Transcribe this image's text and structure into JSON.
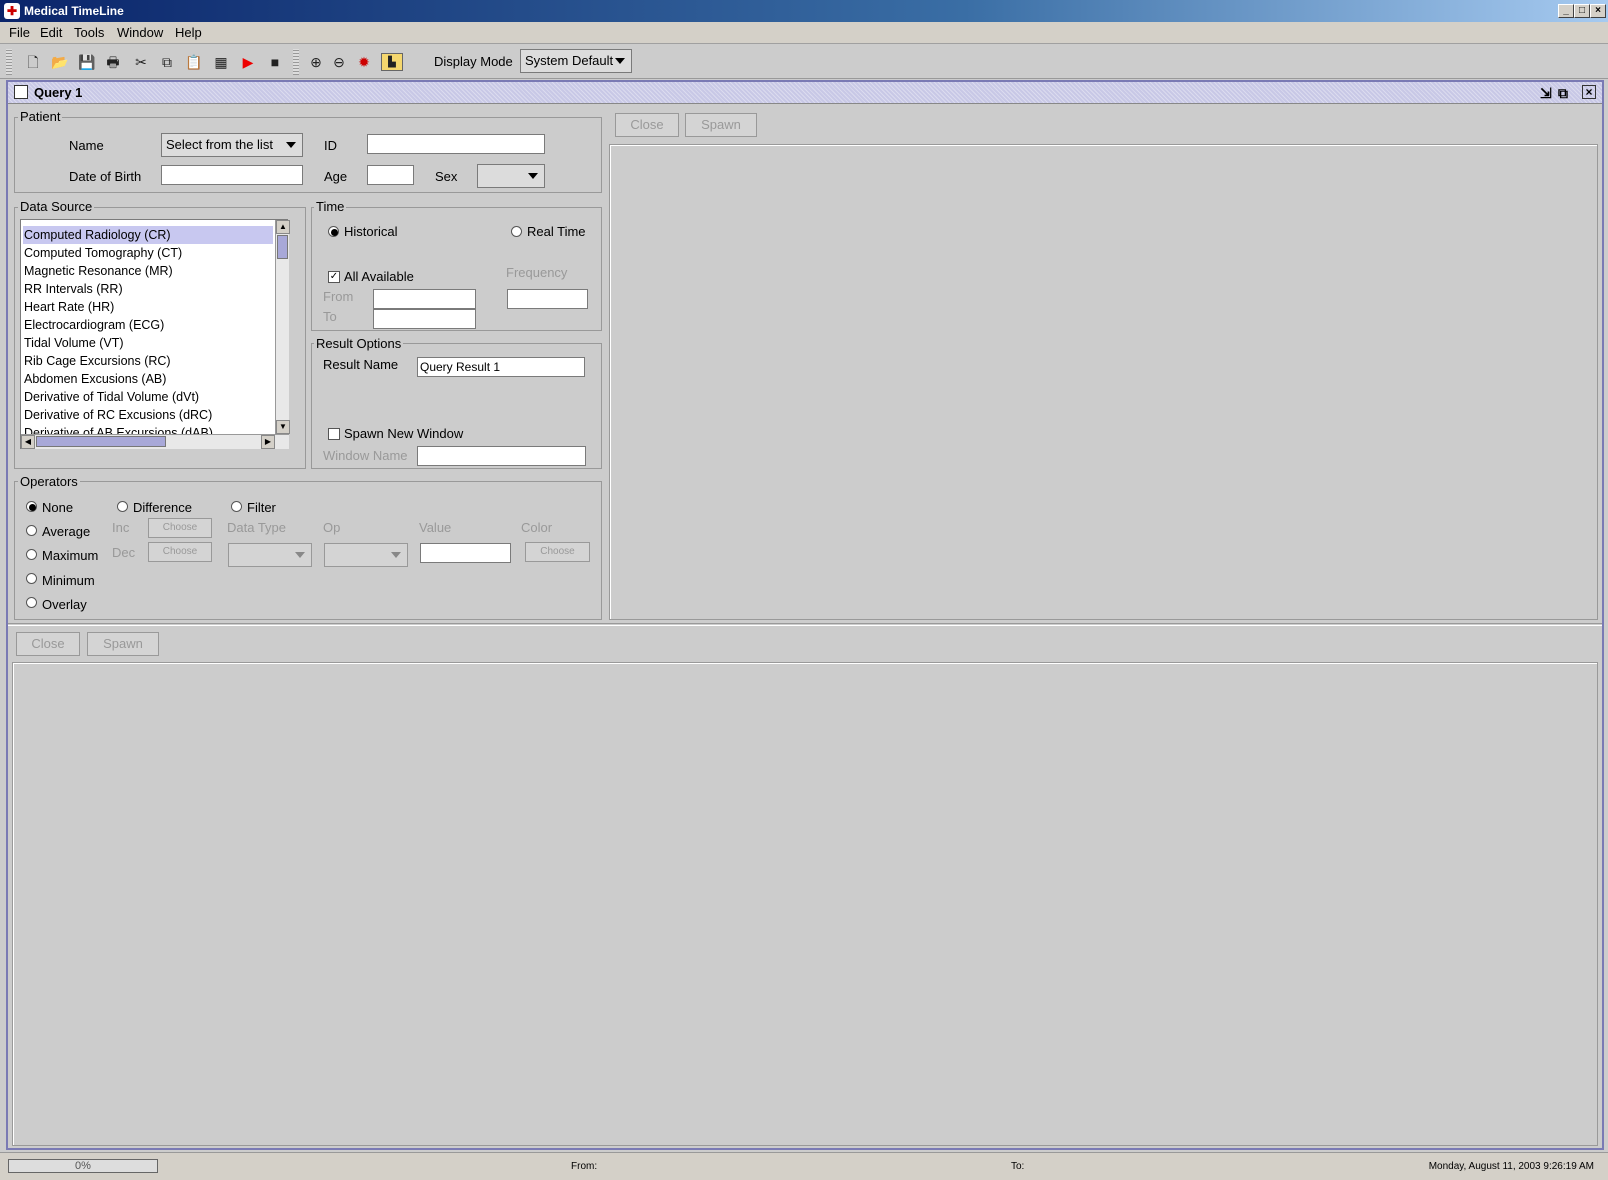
{
  "window": {
    "title": "Medical TimeLine",
    "minimize": "_",
    "maximize": "□",
    "close": "×"
  },
  "menu": [
    "File",
    "Edit",
    "Tools",
    "Window",
    "Help"
  ],
  "toolbar": {
    "display_mode_label": "Display Mode",
    "display_mode_value": "System Default"
  },
  "query_frame": {
    "title": "Query 1"
  },
  "patient": {
    "group_label": "Patient",
    "name_label": "Name",
    "name_value": "Select from the list",
    "id_label": "ID",
    "id_value": "",
    "dob_label": "Date of Birth",
    "dob_value": "",
    "age_label": "Age",
    "age_value": "",
    "sex_label": "Sex",
    "sex_value": ""
  },
  "data_source": {
    "group_label": "Data Source",
    "items": [
      "Computed Radiology (CR)",
      "Computed Tomography (CT)",
      "Magnetic Resonance (MR)",
      "RR Intervals (RR)",
      "Heart Rate (HR)",
      "Electrocardiogram (ECG)",
      "Tidal Volume (VT)",
      "Rib Cage Excursions (RC)",
      "Abdomen Excusions (AB)",
      "Derivative of Tidal Volume (dVt)",
      "Derivative of RC Excusions (dRC)",
      "Derivative of AB Excursions (dAB)"
    ],
    "selected_index": 0
  },
  "time": {
    "group_label": "Time",
    "historical": "Historical",
    "real_time": "Real Time",
    "all_available": "All Available",
    "frequency": "Frequency",
    "from": "From",
    "to": "To"
  },
  "result_options": {
    "group_label": "Result Options",
    "result_name_label": "Result Name",
    "result_name_value": "Query Result 1",
    "spawn_new_window": "Spawn New Window",
    "window_name_label": "Window Name",
    "window_name_value": ""
  },
  "operators": {
    "group_label": "Operators",
    "none": "None",
    "average": "Average",
    "maximum": "Maximum",
    "minimum": "Minimum",
    "overlay": "Overlay",
    "difference": "Difference",
    "filter": "Filter",
    "inc": "Inc",
    "dec": "Dec",
    "choose": "Choose",
    "data_type": "Data Type",
    "op": "Op",
    "value": "Value",
    "color": "Color"
  },
  "right_panel": {
    "close": "Close",
    "spawn": "Spawn"
  },
  "bottom_panel": {
    "close": "Close",
    "spawn": "Spawn"
  },
  "status": {
    "progress": "0%",
    "from": "From:",
    "to": "To:",
    "datetime": "Monday, August 11, 2003 9:26:19 AM"
  },
  "colors": {
    "title_gradient_start": "#0a246a",
    "list_selection": "#c8c8f0",
    "frame_border": "#7a7ab4"
  }
}
